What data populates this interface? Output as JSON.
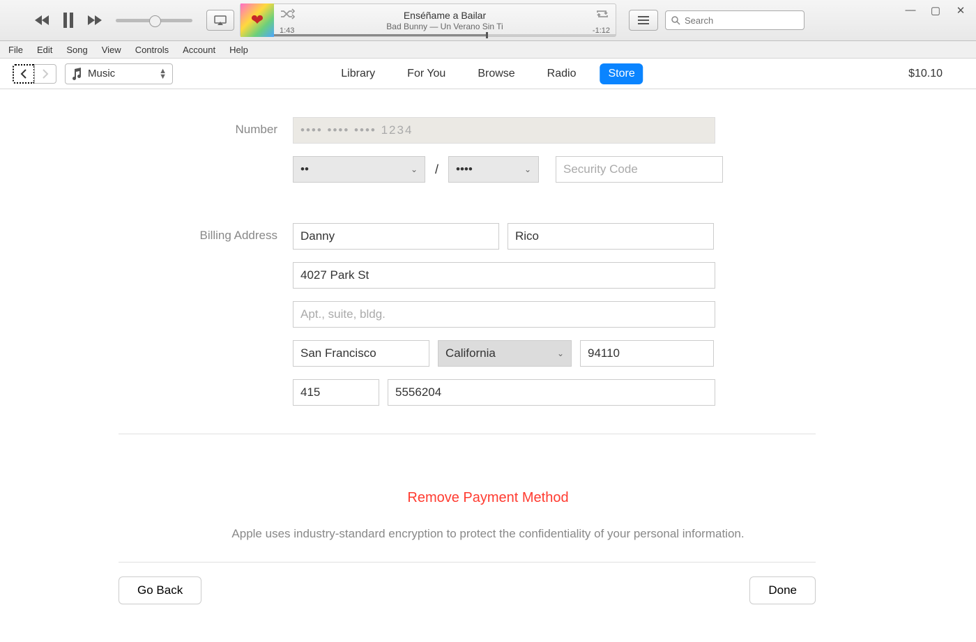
{
  "player": {
    "track_title": "Enséñame a Bailar",
    "track_artist": "Bad Bunny — Un Verano Sin Ti",
    "elapsed": "1:43",
    "remaining": "-1:12"
  },
  "search": {
    "placeholder": "Search"
  },
  "menus": [
    "File",
    "Edit",
    "Song",
    "View",
    "Controls",
    "Account",
    "Help"
  ],
  "media_picker": {
    "label": "Music"
  },
  "nav_tabs": [
    "Library",
    "For You",
    "Browse",
    "Radio",
    "Store"
  ],
  "nav_active": "Store",
  "balance": "$10.10",
  "form": {
    "labels": {
      "number": "Number",
      "billing": "Billing Address"
    },
    "card_masked": "•••• •••• •••• 1234",
    "exp_month": "••",
    "exp_year": "••••",
    "cvv_placeholder": "Security Code",
    "first_name": "Danny",
    "last_name": "Rico",
    "street1": "4027 Park St",
    "street2": "",
    "street2_placeholder": "Apt., suite, bldg.",
    "city": "San Francisco",
    "state": "California",
    "zip": "94110",
    "phone_area": "415",
    "phone_num": "5556204"
  },
  "remove_label": "Remove Payment Method",
  "disclaimer": "Apple uses industry-standard encryption to protect the confidentiality of your personal information.",
  "buttons": {
    "back": "Go Back",
    "done": "Done"
  }
}
